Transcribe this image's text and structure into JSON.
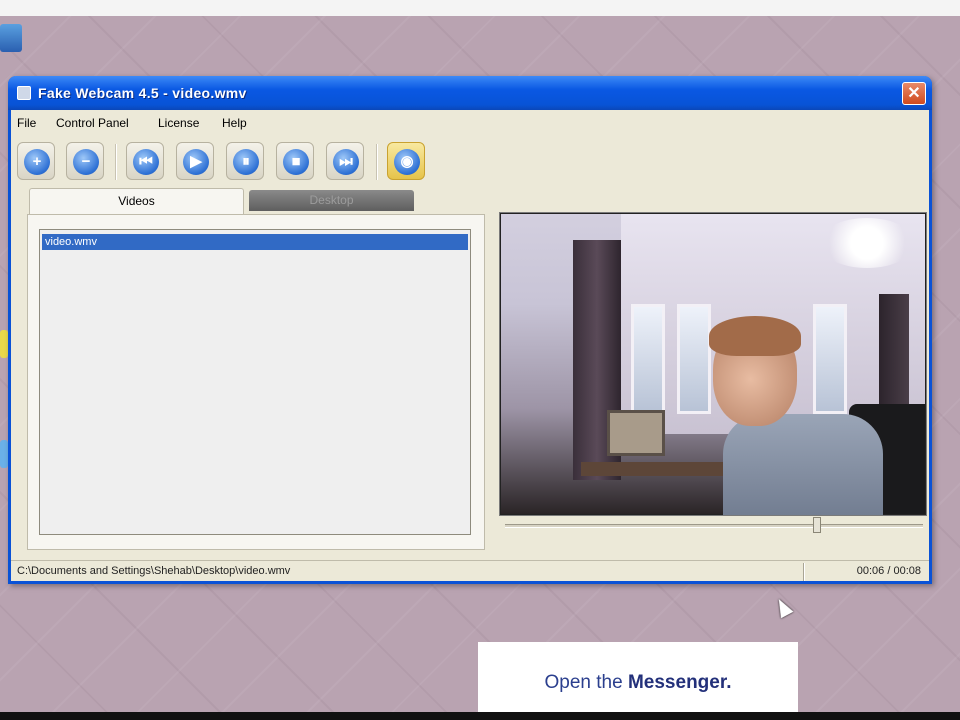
{
  "window": {
    "title": "Fake Webcam 4.5 - video.wmv",
    "close_glyph": "✕"
  },
  "menu": [
    {
      "label": "File"
    },
    {
      "label": "Control Panel"
    },
    {
      "label": "License"
    },
    {
      "label": "Help"
    }
  ],
  "toolbar": [
    {
      "name": "add-button",
      "icon": "plus-icon",
      "glyph": "+"
    },
    {
      "name": "remove-button",
      "icon": "minus-icon",
      "glyph": "−"
    },
    {
      "name": "previous-button",
      "icon": "skip-back-icon",
      "glyph": "⏮"
    },
    {
      "name": "play-button",
      "icon": "play-icon",
      "glyph": "▶"
    },
    {
      "name": "pause-button",
      "icon": "pause-icon",
      "glyph": "⏸"
    },
    {
      "name": "stop-button",
      "icon": "stop-icon",
      "glyph": "■"
    },
    {
      "name": "next-button",
      "icon": "skip-forward-icon",
      "glyph": "⏭"
    },
    {
      "name": "webcam-button",
      "icon": "webcam-icon",
      "glyph": "◉"
    }
  ],
  "tabs": {
    "videos": "Videos",
    "desktop": "Desktop"
  },
  "video_list": [
    {
      "label": "video.wmv",
      "selected": true
    }
  ],
  "player": {
    "seek_fraction": 0.75
  },
  "status": {
    "path": "C:\\Documents and Settings\\Shehab\\Desktop\\video.wmv",
    "time": "00:06 / 00:08"
  },
  "caption": {
    "prefix": "Open the ",
    "highlight": "Messenger."
  },
  "colors": {
    "title_bar": "#0853d6",
    "selection": "#316ac5",
    "desktop_bg": "#b9a3b1",
    "caption_text": "#2b3f8e"
  }
}
